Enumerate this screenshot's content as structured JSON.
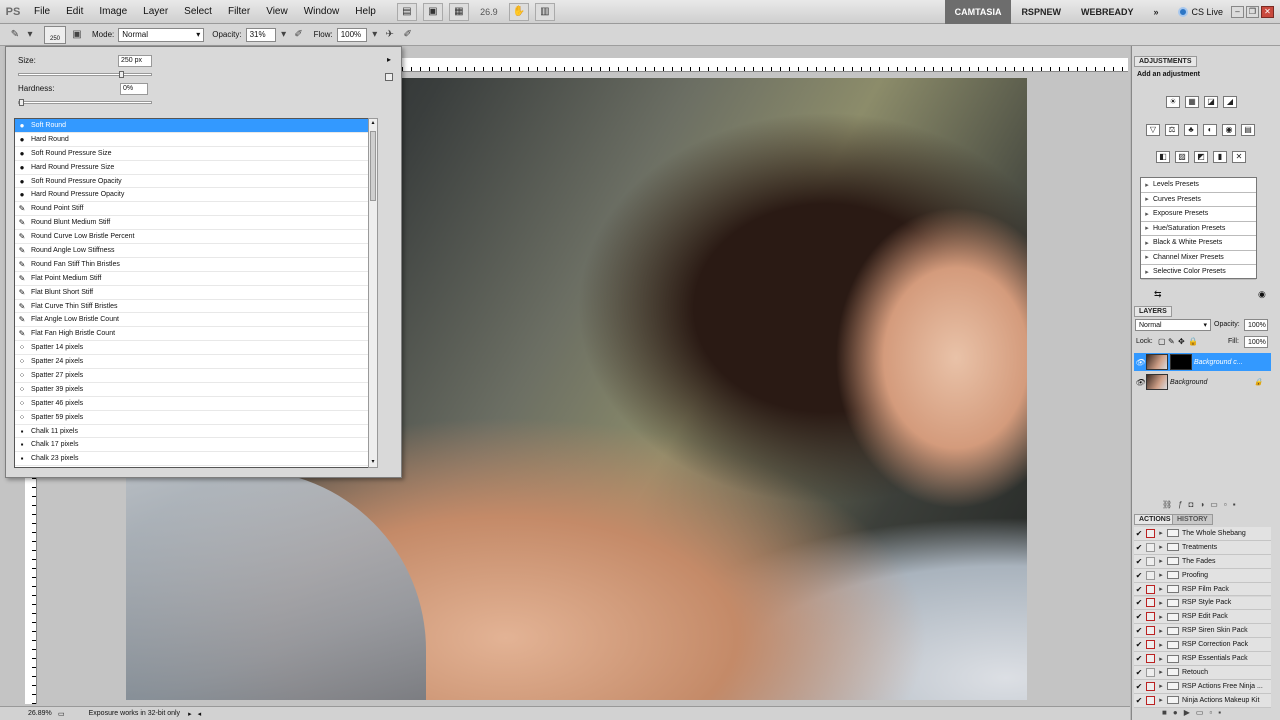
{
  "menubar": {
    "logo": "PS",
    "items": [
      "File",
      "Edit",
      "Image",
      "Layer",
      "Select",
      "Filter",
      "View",
      "Window",
      "Help"
    ],
    "zoom": "26.9",
    "workspaces": [
      "CAMTASIA",
      "RSPNEW",
      "WEBREADY"
    ],
    "more": "»",
    "cslive": "CS Live"
  },
  "options": {
    "brush_size_small": "250",
    "mode_label": "Mode:",
    "mode_value": "Normal",
    "opacity_label": "Opacity:",
    "opacity_value": "31%",
    "flow_label": "Flow:",
    "flow_value": "100%"
  },
  "brush_picker": {
    "size_label": "Size:",
    "size_value": "250 px",
    "size_level": 0.78,
    "hardness_label": "Hardness:",
    "hardness_value": "0%",
    "hardness_level": 0,
    "brushes": [
      {
        "name": "Soft Round",
        "glyph": "●"
      },
      {
        "name": "Hard Round",
        "glyph": "●"
      },
      {
        "name": "Soft Round Pressure Size",
        "glyph": "●"
      },
      {
        "name": "Hard Round Pressure Size",
        "glyph": "●"
      },
      {
        "name": "Soft Round Pressure Opacity",
        "glyph": "●"
      },
      {
        "name": "Hard Round Pressure Opacity",
        "glyph": "●"
      },
      {
        "name": "Round Point Stiff",
        "glyph": "✎"
      },
      {
        "name": "Round Blunt Medium Stiff",
        "glyph": "✎"
      },
      {
        "name": "Round Curve Low Bristle Percent",
        "glyph": "✎"
      },
      {
        "name": "Round Angle Low Stiffness",
        "glyph": "✎"
      },
      {
        "name": "Round Fan Stiff Thin Bristles",
        "glyph": "✎"
      },
      {
        "name": "Flat Point Medium Stiff",
        "glyph": "✎"
      },
      {
        "name": "Flat Blunt Short Stiff",
        "glyph": "✎"
      },
      {
        "name": "Flat Curve Thin Stiff Bristles",
        "glyph": "✎"
      },
      {
        "name": "Flat Angle Low Bristle Count",
        "glyph": "✎"
      },
      {
        "name": "Flat Fan High Bristle Count",
        "glyph": "✎"
      },
      {
        "name": "Spatter 14 pixels",
        "glyph": "⁘"
      },
      {
        "name": "Spatter 24 pixels",
        "glyph": "⁘"
      },
      {
        "name": "Spatter 27 pixels",
        "glyph": "⁘"
      },
      {
        "name": "Spatter 39 pixels",
        "glyph": "⁘"
      },
      {
        "name": "Spatter 46 pixels",
        "glyph": "⁘"
      },
      {
        "name": "Spatter 59 pixels",
        "glyph": "⁘"
      },
      {
        "name": "Chalk 11 pixels",
        "glyph": "▪"
      },
      {
        "name": "Chalk 17 pixels",
        "glyph": "▪"
      },
      {
        "name": "Chalk 23 pixels",
        "glyph": "▪"
      }
    ]
  },
  "adjustments": {
    "tab": "ADJUSTMENTS",
    "heading": "Add an adjustment",
    "icons_row1": [
      "☀",
      "▦",
      "◪",
      "◢"
    ],
    "icons_row2": [
      "▽",
      "⚖",
      "♣",
      "◐",
      "◉",
      "▤"
    ],
    "icons_row3": [
      "◧",
      "▨",
      "◩",
      "▮",
      "✕"
    ],
    "presets": [
      "Levels Presets",
      "Curves Presets",
      "Exposure Presets",
      "Hue/Saturation Presets",
      "Black & White Presets",
      "Channel Mixer Presets",
      "Selective Color Presets"
    ]
  },
  "layers": {
    "tab": "LAYERS",
    "blend_mode": "Normal",
    "opacity_label": "Opacity:",
    "opacity_value": "100%",
    "lock_label": "Lock:",
    "fill_label": "Fill:",
    "fill_value": "100%",
    "items": [
      {
        "name": "Background c..."
      },
      {
        "name": "Background"
      }
    ]
  },
  "actions": {
    "tab_actions": "ACTIONS",
    "tab_history": "HISTORY",
    "items": [
      {
        "name": "The Whole Shebang"
      },
      {
        "name": "Treatments"
      },
      {
        "name": "The Fades"
      },
      {
        "name": "Proofing"
      },
      {
        "name": "RSP Film Pack"
      },
      {
        "name": "RSP Style Pack"
      },
      {
        "name": "RSP Edit Pack"
      },
      {
        "name": "RSP Siren Skin Pack"
      },
      {
        "name": "RSP Correction Pack"
      },
      {
        "name": "RSP Essentials Pack"
      },
      {
        "name": "Retouch"
      },
      {
        "name": "RSP Actions Free Ninja ..."
      },
      {
        "name": "Ninja Actions Makeup Kit"
      }
    ]
  },
  "status": {
    "zoom": "26.89%",
    "message": "Exposure works in 32-bit only"
  },
  "colors": {
    "selection": "#3399ff",
    "active_workspace": "#6d6d6d"
  }
}
